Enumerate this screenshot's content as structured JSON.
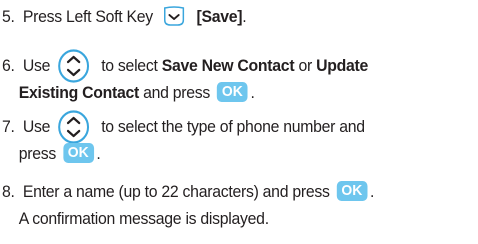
{
  "steps": [
    {
      "number": "5.",
      "line1_a": "Press Left Soft Key",
      "soft_key_icon": "left-soft-key-icon",
      "line1_b": "[Save]",
      "line1_c": "."
    },
    {
      "number": "6.",
      "line1_a": "Use",
      "nav_key_icon": "navigation-key-icon",
      "line1_b": "to select",
      "option1": "Save New Contact",
      "line1_c": "or",
      "option2_part1": "Update",
      "option2_part2": "Existing Contact",
      "line2_a": "and press",
      "ok_label": "OK",
      "line2_b": "."
    },
    {
      "number": "7.",
      "line1_a": "Use",
      "nav_key_icon": "navigation-key-icon",
      "line1_b": "to select the type of phone number and",
      "line2_a": "press",
      "ok_label": "OK",
      "line2_b": "."
    },
    {
      "number": "8.",
      "line1_a": "Enter a name (up to 22 characters) and press",
      "ok_label": "OK",
      "line1_b": ".",
      "line2": "A confirmation message is displayed."
    }
  ],
  "colors": {
    "text": "#231f20",
    "ok_key_fill": "#6ec6ee",
    "nav_key_fill": "#ffffff",
    "nav_key_border": "#3aa6dd",
    "nav_key_arrow": "#231f20"
  }
}
